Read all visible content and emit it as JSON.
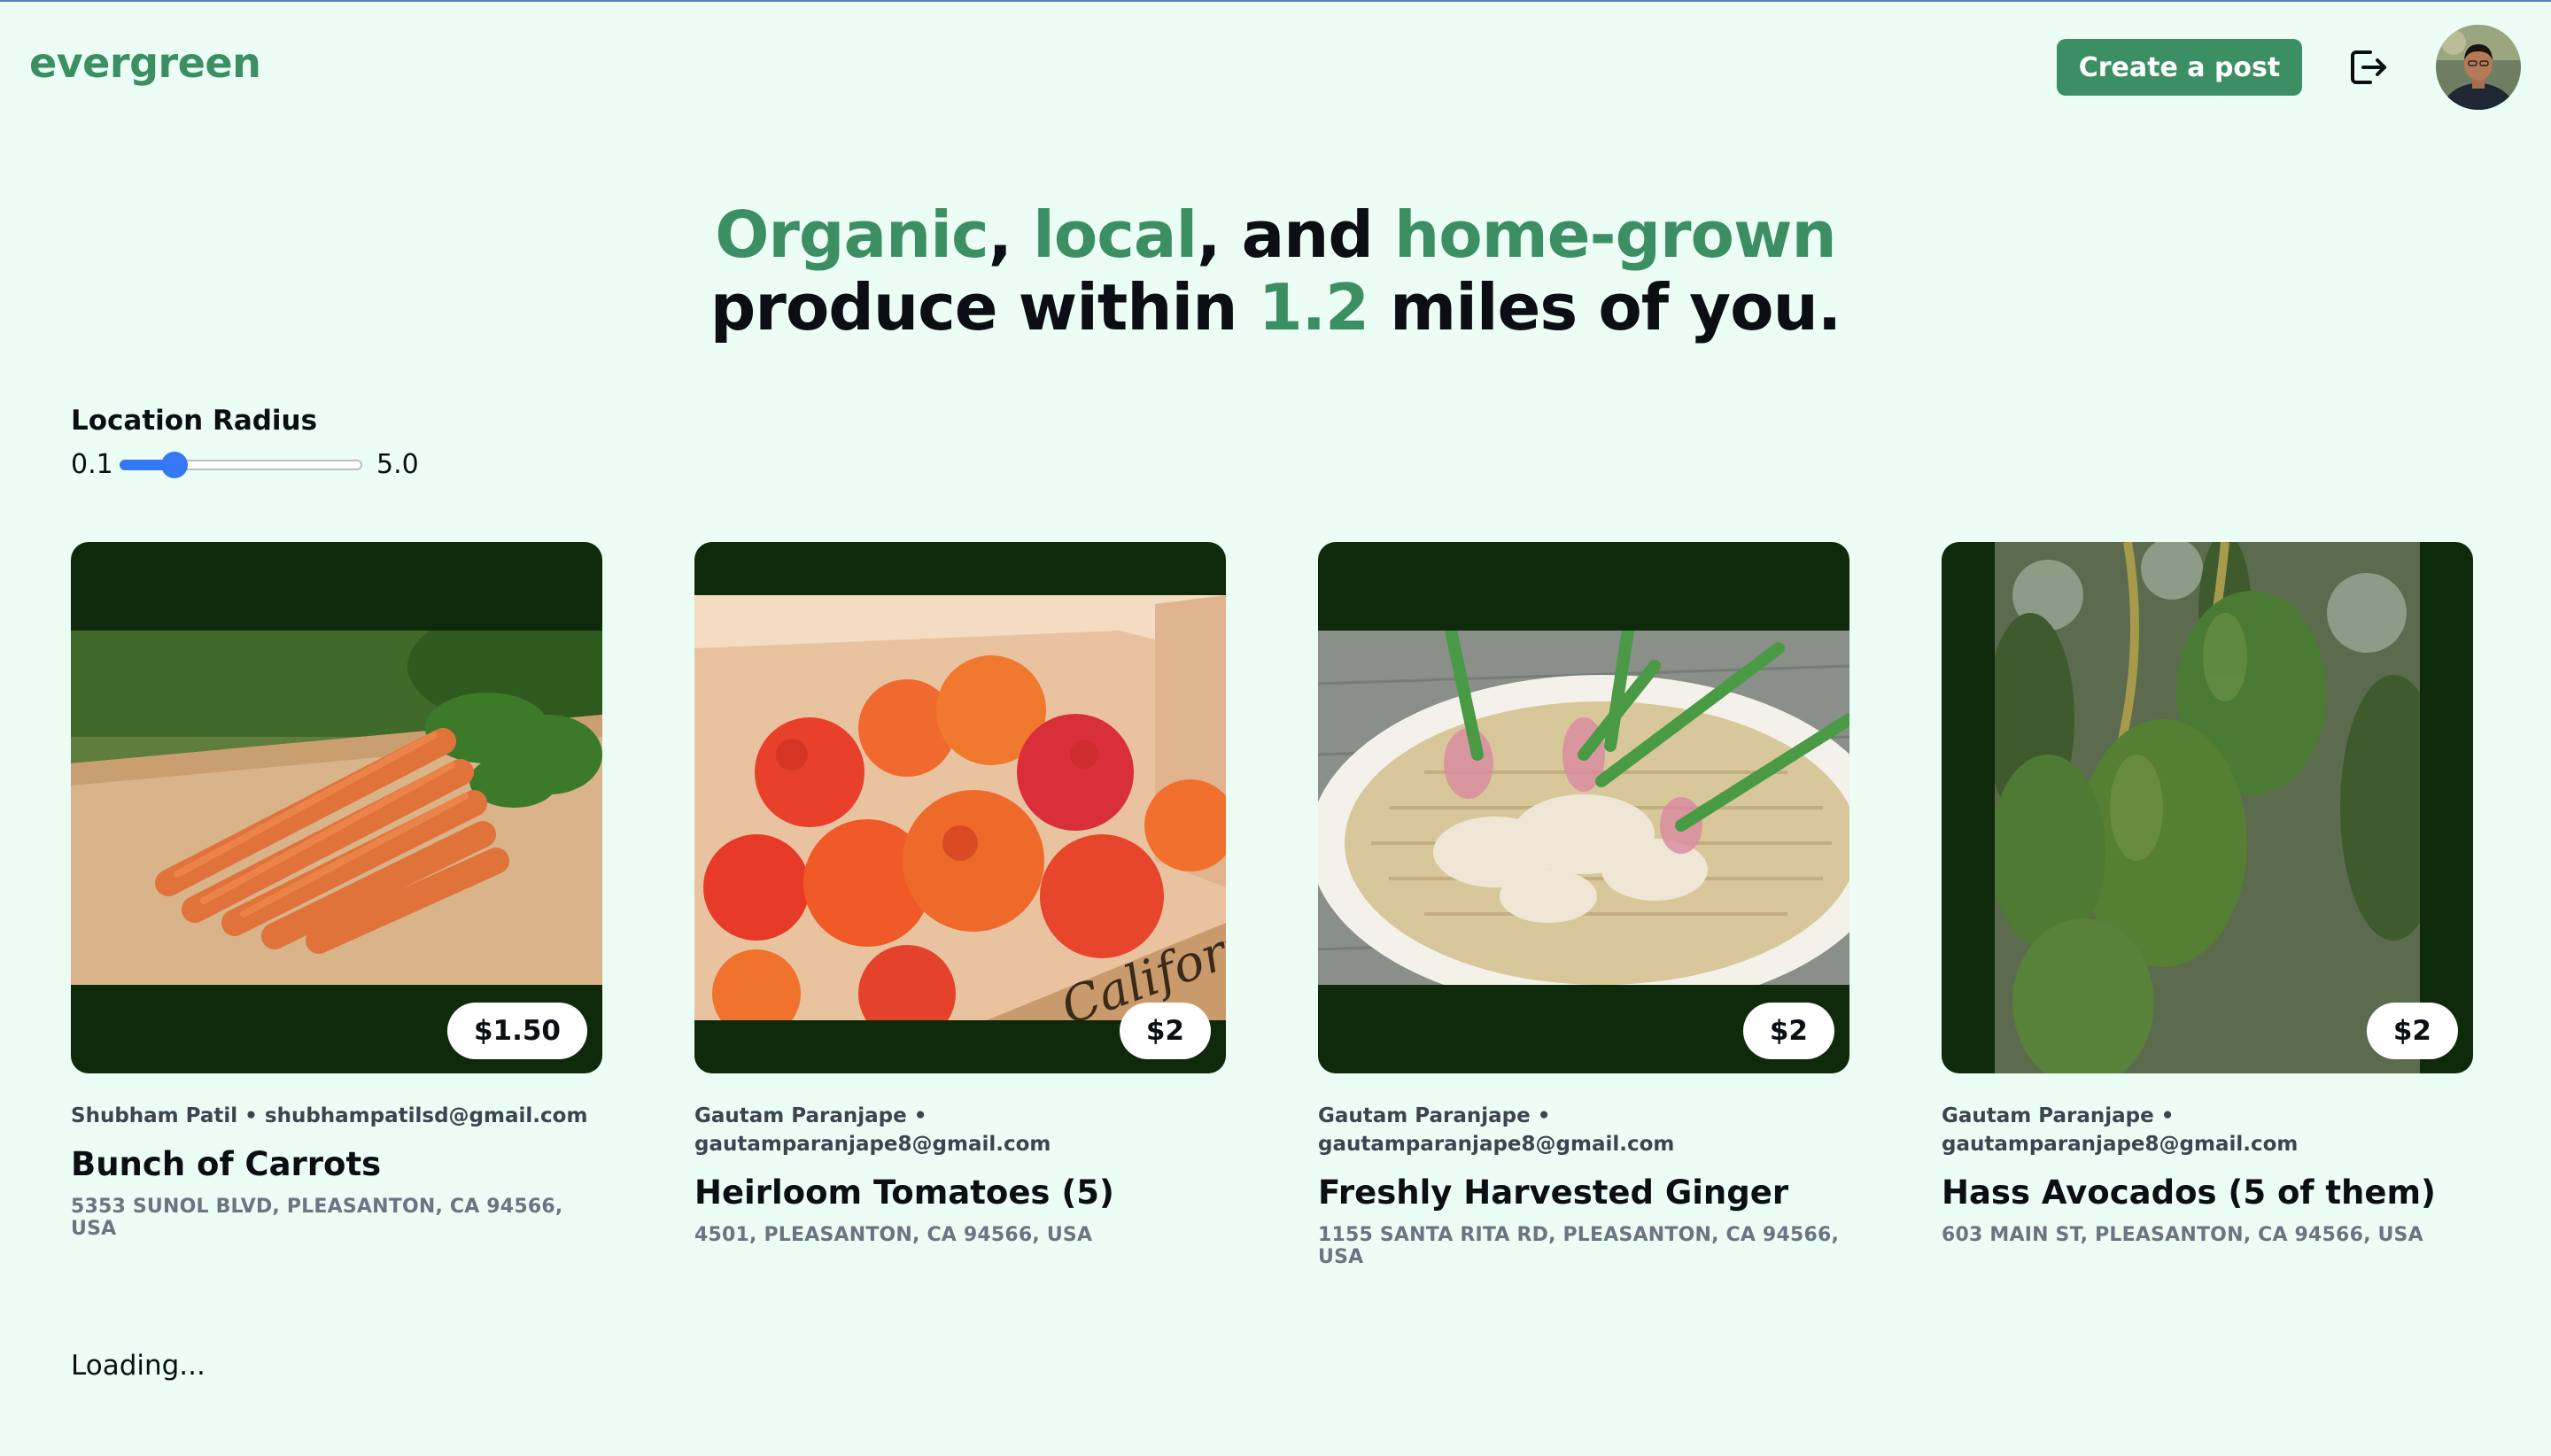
{
  "brand": {
    "name": "evergreen",
    "color": "#3b8f62"
  },
  "header": {
    "create_post_label": "Create a post",
    "logout_icon": "logout-icon",
    "avatar_icon": "user-avatar"
  },
  "hero": {
    "w1": "Organic",
    "s1": ", ",
    "w2": "local",
    "s2": ", and ",
    "w3": "home-grown",
    "line2_start": "produce within ",
    "distance": "1.2",
    "line2_end": " miles of you."
  },
  "filter": {
    "label": "Location Radius",
    "min_label": "0.1",
    "max_label": "5.0",
    "min": 0.1,
    "max": 5.0,
    "value": 1.2
  },
  "listings": [
    {
      "seller_name": "Shubham Patil",
      "sep": " • ",
      "seller_email": "shubhampatilsd@gmail.com",
      "title": "Bunch of Carrots",
      "address": "5353 SUNOL BLVD, PLEASANTON, CA 94566, USA",
      "price": "$1.50",
      "image": "carrots-photo"
    },
    {
      "seller_name": "Gautam Paranjape",
      "sep": " •",
      "seller_email": "gautamparanjape8@gmail.com",
      "title": "Heirloom Tomatoes (5)",
      "address": "4501, PLEASANTON, CA 94566, USA",
      "price": "$2",
      "image": "tomatoes-photo"
    },
    {
      "seller_name": "Gautam Paranjape",
      "sep": " •",
      "seller_email": "gautamparanjape8@gmail.com",
      "title": "Freshly Harvested Ginger",
      "address": "1155 SANTA RITA RD, PLEASANTON, CA 94566, USA",
      "price": "$2",
      "image": "ginger-photo"
    },
    {
      "seller_name": "Gautam Paranjape",
      "sep": " •",
      "seller_email": "gautamparanjape8@gmail.com",
      "title": "Hass Avocados (5 of them)",
      "address": "603 MAIN ST, PLEASANTON, CA 94566, USA",
      "price": "$2",
      "image": "avocados-photo"
    }
  ],
  "status": {
    "loading": "Loading..."
  }
}
